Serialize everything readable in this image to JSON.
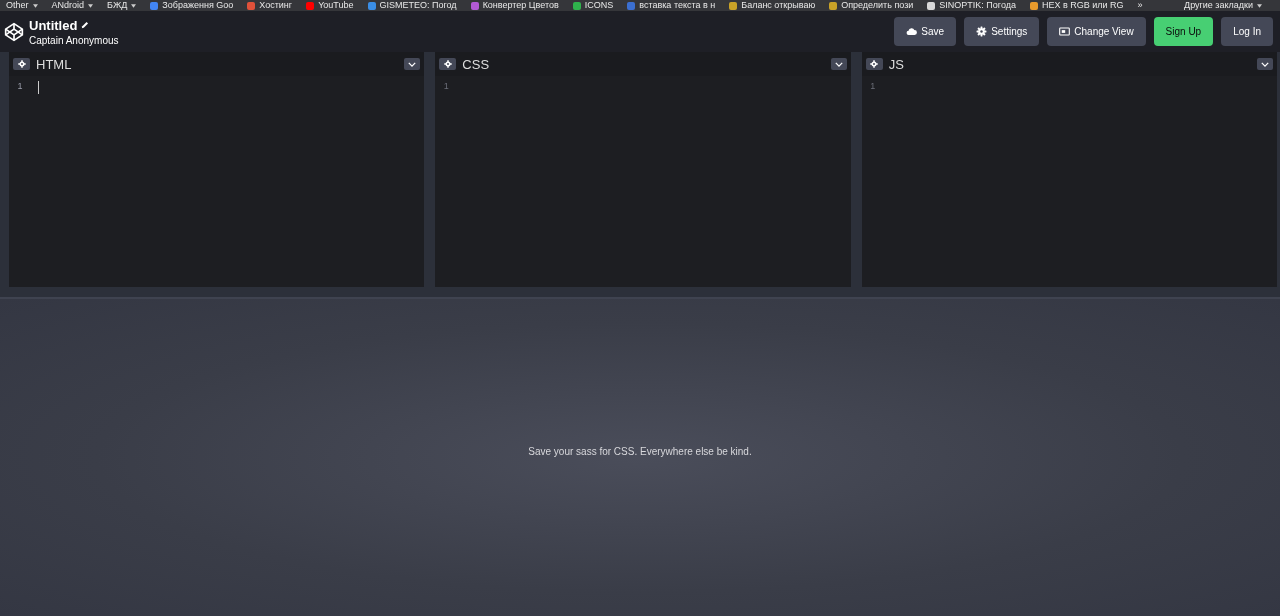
{
  "bookmarks": [
    {
      "label": "Other",
      "kind": "folder"
    },
    {
      "label": "ANdroid",
      "kind": "folder"
    },
    {
      "label": "БЖД",
      "kind": "folder"
    },
    {
      "label": "Зображення Goo",
      "kind": "link",
      "color": "#4285f4"
    },
    {
      "label": "Хостинг",
      "kind": "link",
      "color": "#e0513a"
    },
    {
      "label": "YouTube",
      "kind": "link",
      "color": "#ff0000"
    },
    {
      "label": "GISMETEO: Погод",
      "kind": "link",
      "color": "#3a8ee6"
    },
    {
      "label": "Конвертер Цветов",
      "kind": "link",
      "color": "#b35ad6"
    },
    {
      "label": "ICONS",
      "kind": "link",
      "color": "#2fb24c"
    },
    {
      "label": "вставка текста в н",
      "kind": "link",
      "color": "#3b6fd1"
    },
    {
      "label": "Баланс открываю",
      "kind": "link",
      "color": "#c9a227"
    },
    {
      "label": "Определить пози",
      "kind": "link",
      "color": "#c9a227"
    },
    {
      "label": "SINOPTIK: Погода",
      "kind": "link",
      "color": "#d8d8d8"
    },
    {
      "label": "HEX в RGB или RG",
      "kind": "link",
      "color": "#e89a2c"
    }
  ],
  "bookmarks_more": "»",
  "other_bookmarks": "Другие закладки",
  "header": {
    "title": "Untitled",
    "author": "Captain Anonymous",
    "buttons": [
      {
        "label": "Save",
        "kind": "save"
      },
      {
        "label": "Settings",
        "kind": "settings"
      },
      {
        "label": "Change View",
        "kind": "view"
      },
      {
        "label": "Sign Up",
        "kind": "primary"
      },
      {
        "label": "Log In",
        "kind": "plain"
      }
    ]
  },
  "editors": [
    {
      "title": "HTML",
      "line_numbers": [
        "1"
      ],
      "focused": true
    },
    {
      "title": "CSS",
      "line_numbers": [
        "1"
      ],
      "focused": false
    },
    {
      "title": "JS",
      "line_numbers": [
        "1"
      ],
      "focused": false
    }
  ],
  "preview": {
    "message": "Save your sass for CSS. Everywhere else be kind."
  }
}
